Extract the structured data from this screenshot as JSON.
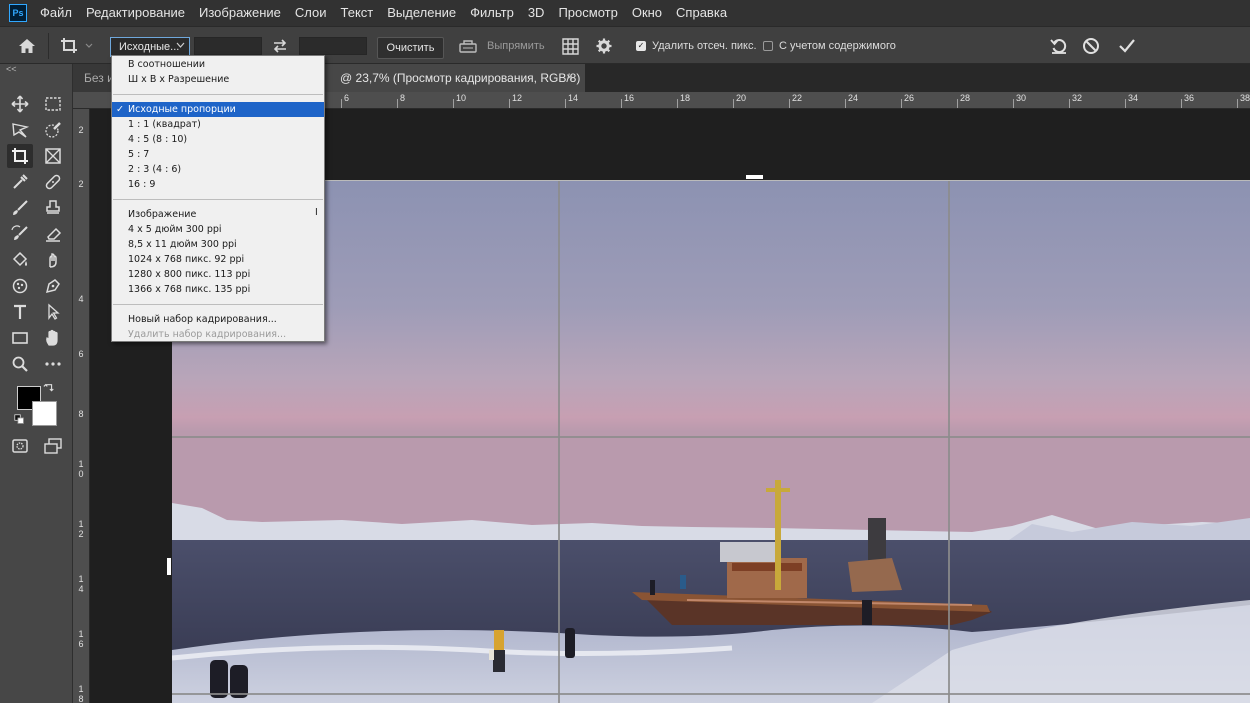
{
  "app": {
    "logo": "Ps"
  },
  "menubar": {
    "items": [
      "Файл",
      "Редактирование",
      "Изображение",
      "Слои",
      "Текст",
      "Выделение",
      "Фильтр",
      "3D",
      "Просмотр",
      "Окно",
      "Справка"
    ]
  },
  "options": {
    "ratio_label": "Исходные...",
    "width_value": "",
    "height_value": "",
    "clear_label": "Очистить",
    "straighten_label": "Выпрямить",
    "delete_cropped_label": "Удалить отсеч. пикс.",
    "delete_cropped_checked": true,
    "content_aware_label": "С учетом содержимого",
    "content_aware_checked": false
  },
  "tabs": {
    "inactive_label": "Без и",
    "active_title": "@ 23,7% (Просмотр кадрирования, RGB/8)",
    "close_glyph": "×"
  },
  "ruler_top": [
    "6",
    "8",
    "10",
    "12",
    "14",
    "16",
    "18",
    "20",
    "22",
    "24",
    "26",
    "28",
    "30",
    "32",
    "34",
    "36",
    "38"
  ],
  "ruler_left": [
    "2",
    "2",
    "4",
    "6",
    "8",
    "1 0",
    "1 2",
    "1 4",
    "1 6",
    "1 8"
  ],
  "dropdown": {
    "group1": [
      "В соотношении",
      "Ш х В х Разрешение"
    ],
    "group2": [
      "Исходные пропорции",
      "1 : 1 (квадрат)",
      "4 : 5 (8 : 10)",
      "5 : 7",
      "2 : 3 (4 : 6)",
      "16 : 9"
    ],
    "selected_index": 0,
    "check_glyph": "✓",
    "group3": [
      "Изображение",
      "4 x 5 дюйм 300 ppi",
      "8,5 x 11 дюйм 300 ppi",
      "1024 x 768 пикс. 92 ppi",
      "1280 x 800 пикс. 113 ppi",
      "1366 x 768 пикс. 135 ppi"
    ],
    "new_preset": "Новый набор кадрирования...",
    "delete_preset": "Удалить набор кадрирования..."
  },
  "colors": {
    "accent": "#1e64c8",
    "foreground": "#000000",
    "background": "#ffffff"
  }
}
